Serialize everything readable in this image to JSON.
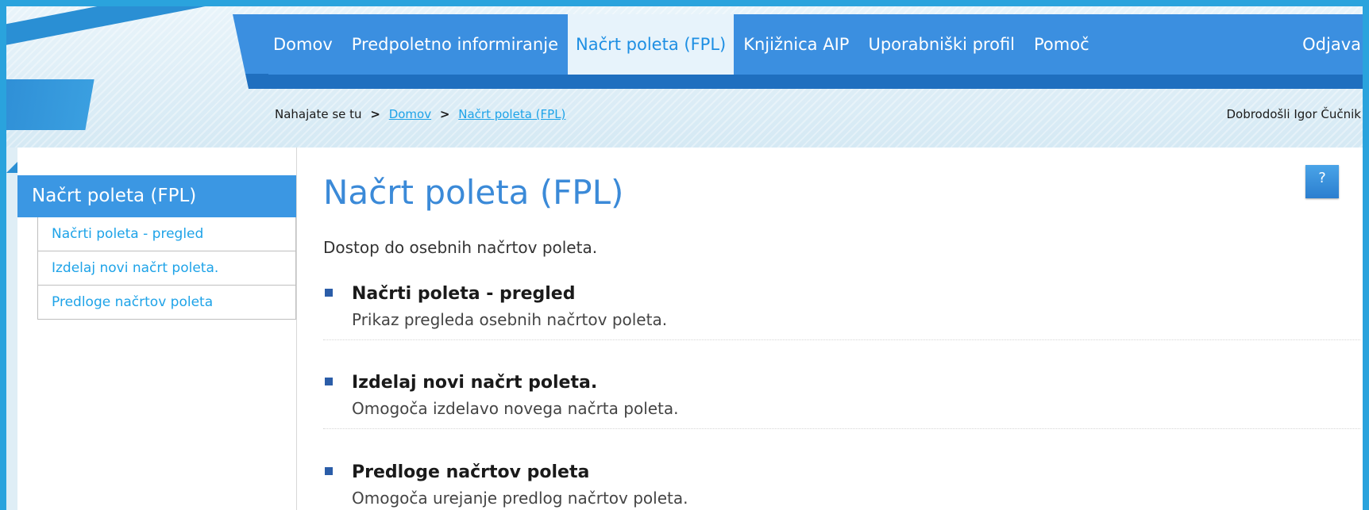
{
  "nav": {
    "items": [
      "Domov",
      "Predpoletno informiranje",
      "Načrt poleta (FPL)",
      "Knjižnica AIP",
      "Uporabniški profil",
      "Pomoč"
    ],
    "active_index": 2,
    "logout": "Odjava"
  },
  "breadcrumb": {
    "prefix": "Nahajate se tu",
    "separator": ">",
    "links": [
      "Domov",
      "Načrt poleta (FPL)"
    ]
  },
  "welcome": "Dobrodošli Igor Čučnik",
  "sidebar": {
    "title": "Načrt poleta (FPL)",
    "items": [
      "Načrti poleta - pregled",
      "Izdelaj novi načrt poleta.",
      "Predloge načrtov poleta"
    ]
  },
  "main": {
    "title": "Načrt poleta (FPL)",
    "intro": "Dostop do osebnih načrtov poleta.",
    "help": "?",
    "entries": [
      {
        "title": "Načrti poleta - pregled",
        "desc": "Prikaz pregleda osebnih načrtov poleta."
      },
      {
        "title": "Izdelaj novi načrt poleta.",
        "desc": "Omogoča izdelavo novega načrta poleta."
      },
      {
        "title": "Predloge načrtov poleta",
        "desc": "Omogoča urejanje predlog načrtov poleta."
      }
    ]
  },
  "colors": {
    "accent": "#3b8fe0",
    "link": "#1ea3e8",
    "frame": "#2aa3dd"
  }
}
